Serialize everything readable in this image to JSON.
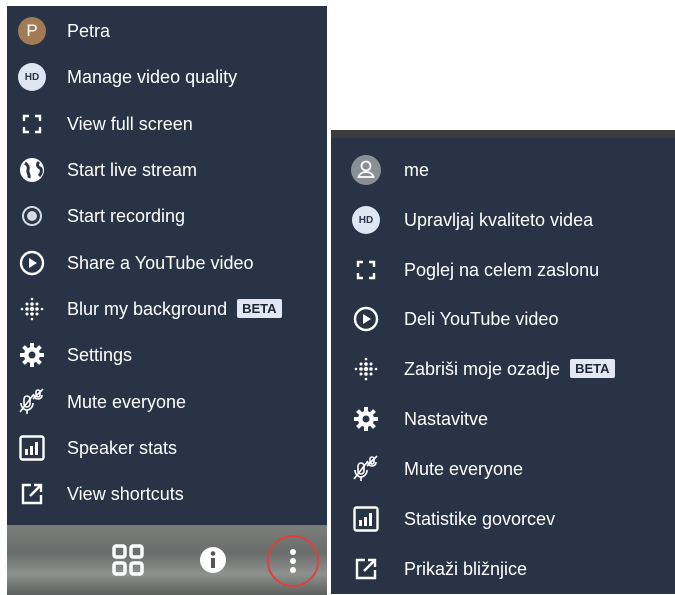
{
  "left_menu": {
    "user": {
      "name": "Petra",
      "avatar_letter": "P"
    },
    "items": [
      {
        "label": "Manage video quality",
        "icon": "hd-icon"
      },
      {
        "label": "View full screen",
        "icon": "fullscreen-icon"
      },
      {
        "label": "Start live stream",
        "icon": "globe-icon"
      },
      {
        "label": "Start recording",
        "icon": "record-icon"
      },
      {
        "label": "Share a YouTube video",
        "icon": "play-circle-icon"
      },
      {
        "label": "Blur my background",
        "icon": "blur-icon",
        "badge": "BETA"
      },
      {
        "label": "Settings",
        "icon": "gear-icon"
      },
      {
        "label": "Mute everyone",
        "icon": "mute-mic-icon"
      },
      {
        "label": "Speaker stats",
        "icon": "stats-icon"
      },
      {
        "label": "View shortcuts",
        "icon": "external-link-icon"
      }
    ],
    "hd_text": "HD"
  },
  "toolbar": {
    "buttons": [
      {
        "name": "grid-view",
        "icon": "grid-icon"
      },
      {
        "name": "info",
        "icon": "info-icon"
      },
      {
        "name": "more-options",
        "icon": "more-vertical-icon"
      }
    ]
  },
  "right_menu": {
    "user": {
      "name": "me"
    },
    "hd_text": "HD",
    "items": [
      {
        "label": "Upravljaj kvaliteto videa",
        "icon": "hd-icon"
      },
      {
        "label": "Poglej na celem zaslonu",
        "icon": "fullscreen-icon"
      },
      {
        "label": "Deli YouTube video",
        "icon": "play-circle-icon"
      },
      {
        "label": "Zabriši moje ozadje",
        "icon": "blur-icon",
        "badge": "BETA"
      },
      {
        "label": "Nastavitve",
        "icon": "gear-icon"
      },
      {
        "label": "Mute everyone",
        "icon": "mute-mic-icon"
      },
      {
        "label": "Statistike govorcev",
        "icon": "stats-icon"
      },
      {
        "label": "Prikaži bližnjice",
        "icon": "external-link-icon"
      }
    ]
  },
  "colors": {
    "menu_bg": "#283446",
    "text": "#ffffff",
    "badge_bg": "#e1e8f3",
    "avatar_petra": "#a07b55",
    "avatar_me": "#8a8f97",
    "highlight_ring": "#e0403a"
  }
}
